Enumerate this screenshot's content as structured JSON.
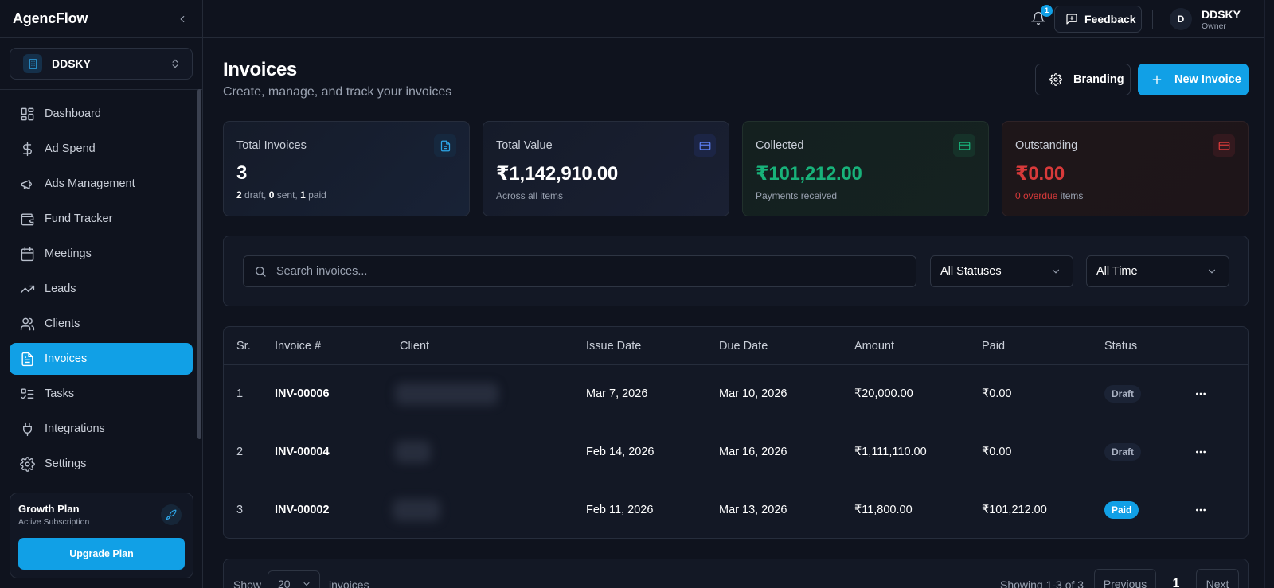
{
  "app": {
    "name": "AgencFlow"
  },
  "workspace": {
    "name": "DDSKY"
  },
  "sidebar": {
    "items": [
      {
        "label": "Dashboard",
        "icon": "dashboard-icon"
      },
      {
        "label": "Ad Spend",
        "icon": "dollar-icon"
      },
      {
        "label": "Ads Management",
        "icon": "megaphone-icon"
      },
      {
        "label": "Fund Tracker",
        "icon": "wallet-icon"
      },
      {
        "label": "Meetings",
        "icon": "calendar-icon"
      },
      {
        "label": "Leads",
        "icon": "trending-up-icon"
      },
      {
        "label": "Clients",
        "icon": "users-icon"
      },
      {
        "label": "Invoices",
        "icon": "file-text-icon",
        "active": true
      },
      {
        "label": "Tasks",
        "icon": "list-checks-icon"
      },
      {
        "label": "Integrations",
        "icon": "plug-icon"
      },
      {
        "label": "Settings",
        "icon": "gear-icon"
      }
    ],
    "plan": {
      "title": "Growth Plan",
      "subtitle": "Active Subscription",
      "button": "Upgrade Plan"
    }
  },
  "topbar": {
    "notification_count": "1",
    "feedback_label": "Feedback",
    "user": {
      "initial": "D",
      "name": "DDSKY",
      "role": "Owner"
    }
  },
  "header": {
    "title": "Invoices",
    "subtitle": "Create, manage, and track your invoices",
    "branding_label": "Branding",
    "new_invoice_label": "New Invoice"
  },
  "stats": {
    "total_invoices": {
      "label": "Total Invoices",
      "value": "3",
      "draft_count": "2",
      "draft_text": " draft, ",
      "sent_count": "0",
      "sent_text": " sent, ",
      "paid_count": "1",
      "paid_text": " paid"
    },
    "total_value": {
      "label": "Total Value",
      "value": "₹1,142,910.00",
      "note": "Across all items"
    },
    "collected": {
      "label": "Collected",
      "value": "₹101,212.00",
      "note": "Payments received"
    },
    "outstanding": {
      "label": "Outstanding",
      "value": "₹0.00",
      "overdue": "0 overdue",
      "note_suffix": " items"
    }
  },
  "filters": {
    "search_placeholder": "Search invoices...",
    "status_value": "All Statuses",
    "time_value": "All Time"
  },
  "table": {
    "headers": {
      "sr": "Sr.",
      "invoice": "Invoice #",
      "client": "Client",
      "issue": "Issue Date",
      "due": "Due Date",
      "amount": "Amount",
      "paid": "Paid",
      "status": "Status"
    },
    "rows": [
      {
        "sr": "1",
        "invoice": "INV-00006",
        "issue": "Mar 7, 2026",
        "due": "Mar 10, 2026",
        "amount": "₹20,000.00",
        "paid": "₹0.00",
        "status": "Draft"
      },
      {
        "sr": "2",
        "invoice": "INV-00004",
        "issue": "Feb 14, 2026",
        "due": "Mar 16, 2026",
        "amount": "₹1,111,110.00",
        "paid": "₹0.00",
        "status": "Draft"
      },
      {
        "sr": "3",
        "invoice": "INV-00002",
        "issue": "Feb 11, 2026",
        "due": "Mar 13, 2026",
        "amount": "₹11,800.00",
        "paid": "₹101,212.00",
        "status": "Paid"
      }
    ]
  },
  "pagination": {
    "show_label": "Show",
    "page_size": "20",
    "invoices_label": "invoices",
    "showing": "Showing 1-3 of 3",
    "previous": "Previous",
    "current_page": "1",
    "next": "Next"
  },
  "colors": {
    "accent": "#11a0e6",
    "success": "#18b27a",
    "danger": "#d83a3a",
    "background": "#0f131e"
  }
}
